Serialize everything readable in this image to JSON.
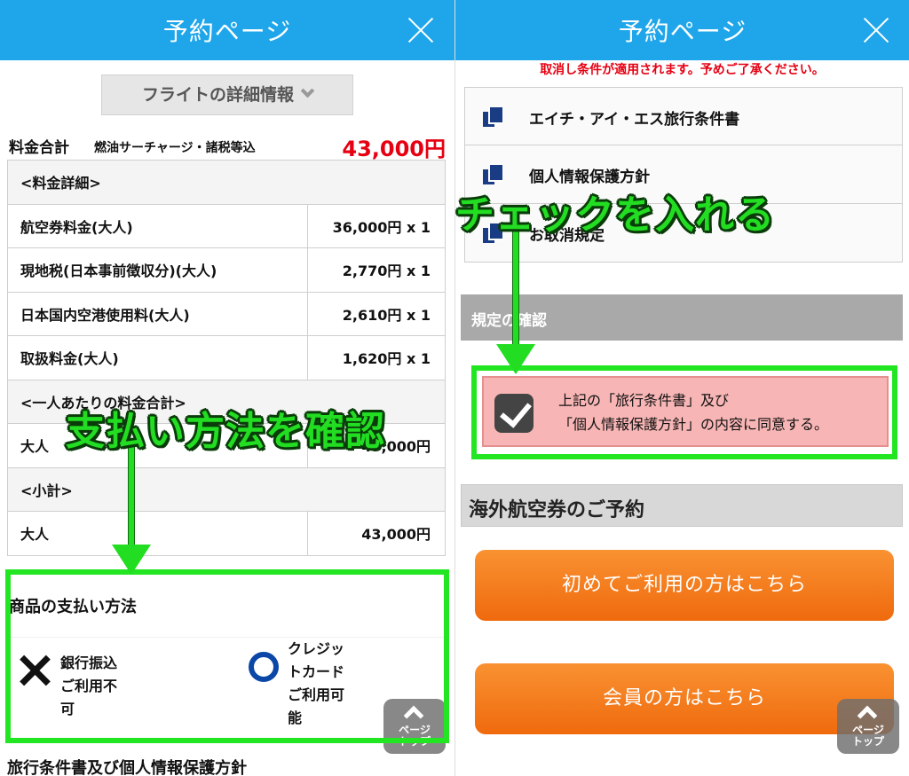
{
  "left": {
    "header": {
      "title": "予約ページ"
    },
    "flight_details_button": "フライトの詳細情報",
    "fare_total": {
      "label": "料金合計",
      "sub": "燃油サーチャージ・諸税等込",
      "amount": "43,000円"
    },
    "fare_table": [
      {
        "label": "<料金詳細>",
        "value": "",
        "section": true
      },
      {
        "label": "航空券料金(大人)",
        "value": "36,000円 x 1"
      },
      {
        "label": "現地税(日本事前徴収分)(大人)",
        "value": "2,770円 x 1"
      },
      {
        "label": "日本国内空港使用料(大人)",
        "value": "2,610円 x 1"
      },
      {
        "label": "取扱料金(大人)",
        "value": "1,620円 x 1"
      },
      {
        "label": "<一人あたりの料金合計>",
        "value": "",
        "section": true
      },
      {
        "label": "大人",
        "value": "43,000円"
      },
      {
        "label": "<小計>",
        "value": "",
        "section": true
      },
      {
        "label": "大人",
        "value": "43,000円"
      }
    ],
    "payment": {
      "title": "商品の支払い方法",
      "bank": [
        "銀行振込",
        "ご利用不",
        "可"
      ],
      "card": [
        "クレジッ",
        "トカード",
        "ご利用可",
        "能"
      ]
    },
    "policy_heading": "旅行条件書及び個人情報保護方針",
    "page_top": [
      "ページ",
      "トップ"
    ],
    "annotation": "支払い方法を確認"
  },
  "right": {
    "header": {
      "title": "予約ページ"
    },
    "cancel_note": "取消し条件が適用されます。予めご了承ください。",
    "documents": [
      "エイチ・アイ・エス旅行条件書",
      "個人情報保護方針",
      "お取消規定"
    ],
    "rules_bar": "規定の確認",
    "agree": [
      "上記の「旅行条件書」及び",
      "「個人情報保護方針」の内容に同意する。"
    ],
    "booking_heading": "海外航空券のご予約",
    "buttons": {
      "first_time": "初めてご利用の方はこちら",
      "member": "会員の方はこちら"
    },
    "page_top": [
      "ページ",
      "トップ"
    ],
    "annotation": "チェックを入れる"
  },
  "colors": {
    "header": "#1fa6ea",
    "price": "#e60012",
    "annotation": "#22dd22",
    "button": "#f58220"
  }
}
